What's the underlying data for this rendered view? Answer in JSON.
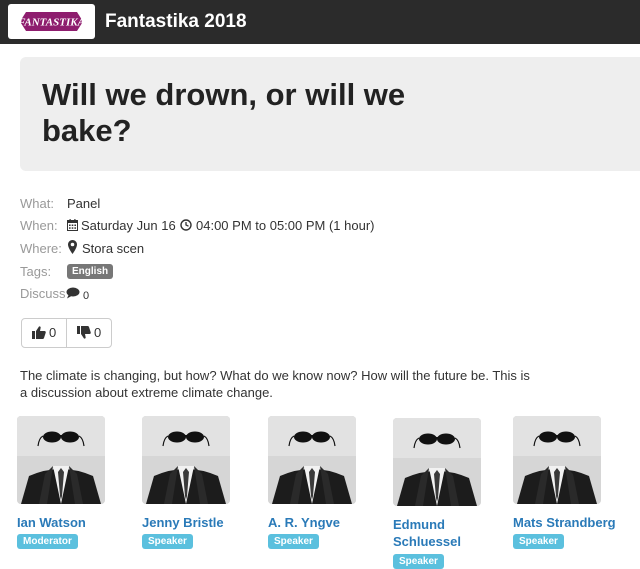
{
  "navbar": {
    "logo_text": "FANTASTIKA",
    "brand": "Fantastika 2018"
  },
  "event": {
    "title": "Will we drown, or will we bake?"
  },
  "meta": {
    "what_label": "What:",
    "what_value": "Panel",
    "when_label": "When:",
    "date": "Saturday Jun 16",
    "time": "04:00 PM to 05:00 PM (1 hour)",
    "where_label": "Where:",
    "location": "Stora scen",
    "tags_label": "Tags:",
    "tag": "English",
    "discussion_label": "Discussion:",
    "discussion_count": "0"
  },
  "votes": {
    "up_count": "0",
    "down_count": "0"
  },
  "description": "The climate is changing, but how? What do we know now? How will the future be. This is a discussion about extreme climate change.",
  "speakers": [
    {
      "name": "Ian Watson",
      "role": "Moderator"
    },
    {
      "name": "Jenny Bristle",
      "role": "Speaker"
    },
    {
      "name": "A. R. Yngve",
      "role": "Speaker"
    },
    {
      "name": "Edmund Schluessel",
      "role": "Speaker"
    },
    {
      "name": "Mats Strandberg",
      "role": "Speaker"
    }
  ],
  "colors": {
    "navbar": "#2b2b2b",
    "logo": "#8e1d6e",
    "link": "#2a7ab8",
    "role_badge": "#5bc0de",
    "tag_badge": "#777777",
    "jumbotron": "#eeeeee"
  },
  "icons": {
    "date": "calendar-icon",
    "time": "clock-icon",
    "location": "map-marker-icon",
    "discussion": "comment-icon",
    "upvote": "thumbs-up-icon",
    "downvote": "thumbs-down-icon"
  }
}
